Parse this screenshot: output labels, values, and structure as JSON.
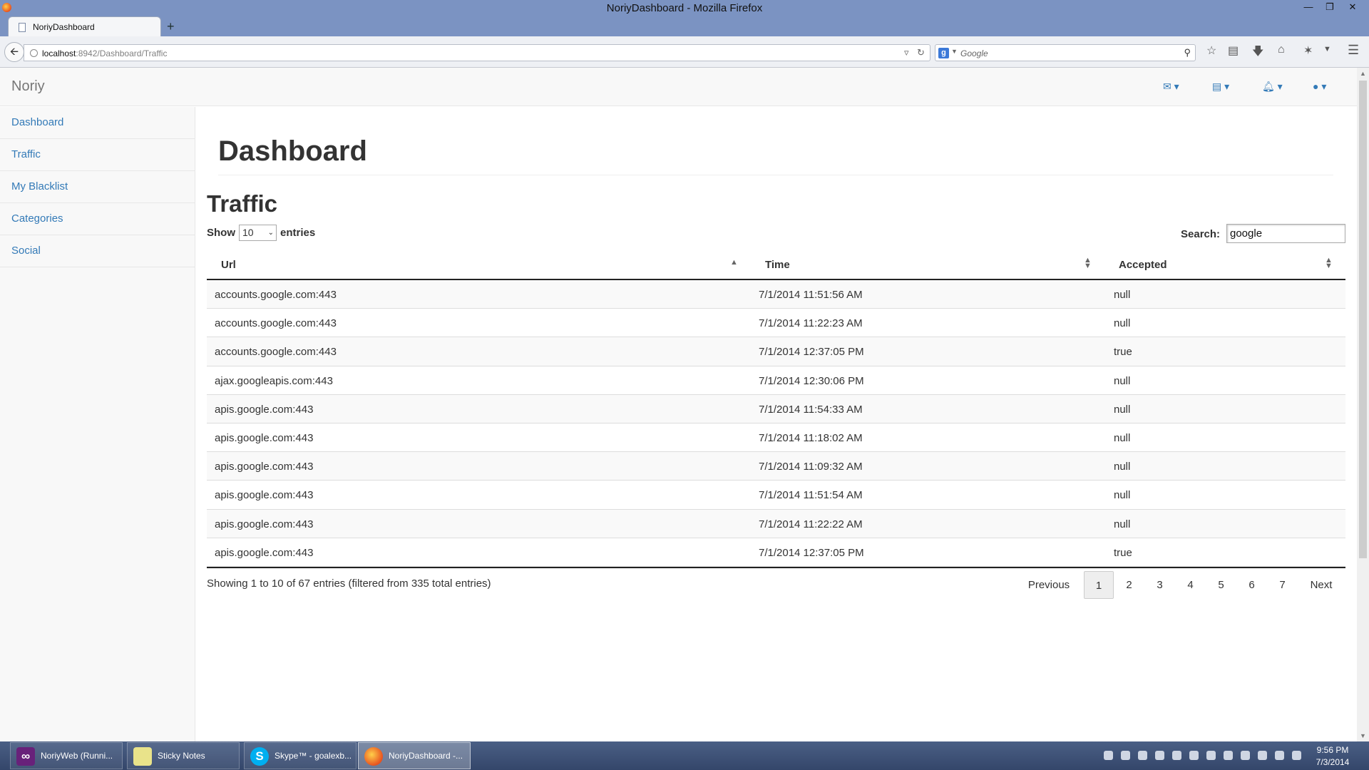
{
  "browser": {
    "window_title": "NoriyDashboard - Mozilla Firefox",
    "tab_title": "NoriyDashboard",
    "url_host": "localhost",
    "url_path": ":8942/Dashboard/Traffic",
    "search_engine_placeholder": "Google",
    "search_badge": "g"
  },
  "app": {
    "brand": "Noriy",
    "accent_color": "#337ab7",
    "sidebar": [
      {
        "label": "Dashboard"
      },
      {
        "label": "Traffic"
      },
      {
        "label": "My Blacklist"
      },
      {
        "label": "Categories"
      },
      {
        "label": "Social"
      }
    ],
    "header_icons": [
      "envelope-icon",
      "tasks-icon",
      "bell-icon",
      "user-icon"
    ]
  },
  "page": {
    "title": "Dashboard",
    "section_title": "Traffic"
  },
  "table": {
    "show_label": "Show",
    "entries_value": "10",
    "entries_label": "entries",
    "search_label": "Search:",
    "search_value": "google",
    "columns": [
      "Url",
      "Time",
      "Accepted"
    ],
    "rows": [
      {
        "url": "accounts.google.com:443",
        "time": "7/1/2014 11:51:56 AM",
        "accepted": "null"
      },
      {
        "url": "accounts.google.com:443",
        "time": "7/1/2014 11:22:23 AM",
        "accepted": "null"
      },
      {
        "url": "accounts.google.com:443",
        "time": "7/1/2014 12:37:05 PM",
        "accepted": "true"
      },
      {
        "url": "ajax.googleapis.com:443",
        "time": "7/1/2014 12:30:06 PM",
        "accepted": "null"
      },
      {
        "url": "apis.google.com:443",
        "time": "7/1/2014 11:54:33 AM",
        "accepted": "null"
      },
      {
        "url": "apis.google.com:443",
        "time": "7/1/2014 11:18:02 AM",
        "accepted": "null"
      },
      {
        "url": "apis.google.com:443",
        "time": "7/1/2014 11:09:32 AM",
        "accepted": "null"
      },
      {
        "url": "apis.google.com:443",
        "time": "7/1/2014 11:51:54 AM",
        "accepted": "null"
      },
      {
        "url": "apis.google.com:443",
        "time": "7/1/2014 11:22:22 AM",
        "accepted": "null"
      },
      {
        "url": "apis.google.com:443",
        "time": "7/1/2014 12:37:05 PM",
        "accepted": "true"
      }
    ],
    "info": "Showing 1 to 10 of 67 entries (filtered from 335 total entries)",
    "pagination": {
      "previous": "Previous",
      "pages": [
        "1",
        "2",
        "3",
        "4",
        "5",
        "6",
        "7"
      ],
      "active_page": "1",
      "next": "Next"
    }
  },
  "taskbar": {
    "items": [
      {
        "label": "NoriyWeb (Runni...",
        "icon": "visual-studio-icon"
      },
      {
        "label": "Sticky Notes",
        "icon": "sticky-notes-icon"
      },
      {
        "label": "Skype™ - goalexb...",
        "icon": "skype-icon"
      },
      {
        "label": "NoriyDashboard -...",
        "icon": "firefox-icon"
      }
    ],
    "clock_time": "9:56 PM",
    "clock_date": "7/3/2014"
  }
}
